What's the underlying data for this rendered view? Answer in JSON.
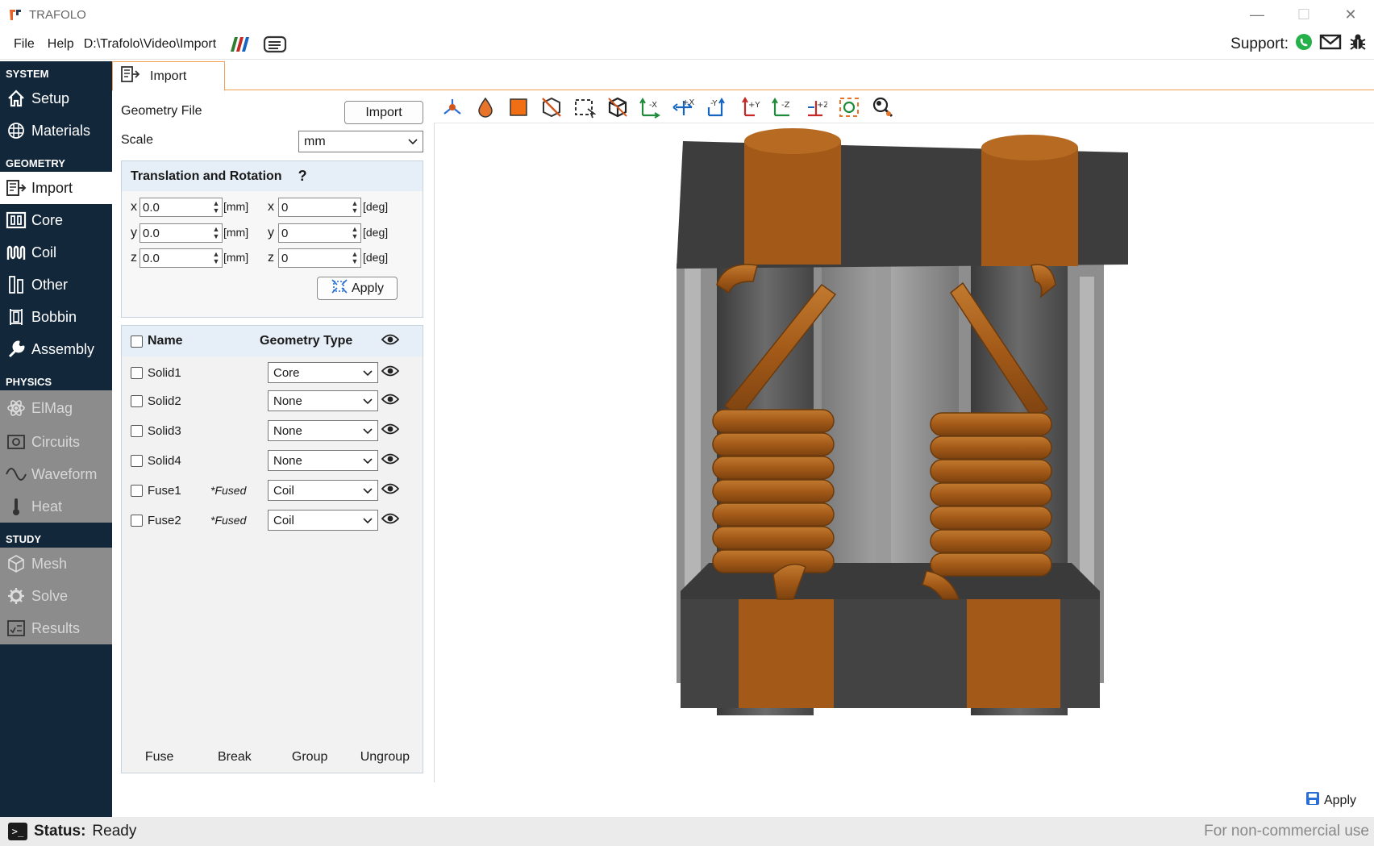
{
  "window": {
    "title": "TRAFOLO",
    "minimize": "—",
    "maximize": "☐",
    "close": "✕"
  },
  "menubar": {
    "file": "File",
    "help": "Help",
    "path": "D:\\Trafolo\\Video\\Import",
    "support_label": "Support:"
  },
  "sidebar": {
    "system_header": "SYSTEM",
    "setup": "Setup",
    "materials": "Materials",
    "geometry_header": "GEOMETRY",
    "import": "Import",
    "core": "Core",
    "coil": "Coil",
    "other": "Other",
    "bobbin": "Bobbin",
    "assembly": "Assembly",
    "physics_header": "PHYSICS",
    "elmag": "ElMag",
    "circuits": "Circuits",
    "waveform": "Waveform",
    "heat": "Heat",
    "study_header": "STUDY",
    "mesh": "Mesh",
    "solve": "Solve",
    "results": "Results"
  },
  "tab": {
    "label": "Import"
  },
  "panel": {
    "geometry_file_label": "Geometry File",
    "import_button": "Import",
    "scale_label": "Scale",
    "scale_value": "mm",
    "translation_title": "Translation and Rotation",
    "help_mark": "?",
    "trans": {
      "x_label": "x",
      "x_value": "0.0",
      "x_unit": "[mm]",
      "y_label": "y",
      "y_value": "0.0",
      "y_unit": "[mm]",
      "z_label": "z",
      "z_value": "0.0",
      "z_unit": "[mm]"
    },
    "rot": {
      "x_label": "x",
      "x_value": "0",
      "x_unit": "[deg]",
      "y_label": "y",
      "y_value": "0",
      "y_unit": "[deg]",
      "z_label": "z",
      "z_value": "0",
      "z_unit": "[deg]"
    },
    "apply_button": "Apply",
    "table": {
      "col_name": "Name",
      "col_type": "Geometry Type",
      "rows": [
        {
          "name": "Solid1",
          "fused": "",
          "type": "Core"
        },
        {
          "name": "Solid2",
          "fused": "",
          "type": "None"
        },
        {
          "name": "Solid3",
          "fused": "",
          "type": "None"
        },
        {
          "name": "Solid4",
          "fused": "",
          "type": "None"
        },
        {
          "name": "Fuse1",
          "fused": "*Fused",
          "type": "Coil"
        },
        {
          "name": "Fuse2",
          "fused": "*Fused",
          "type": "Coil"
        }
      ]
    },
    "footer": {
      "fuse": "Fuse",
      "break": "Break",
      "group": "Group",
      "ungroup": "Ungroup"
    }
  },
  "toolbar": {
    "labels": {
      "neg_x": "-X",
      "pos_x": "+X",
      "neg_y": "-Y",
      "pos_y": "+Y",
      "neg_z": "-Z",
      "pos_z": "+Z"
    }
  },
  "bottom_apply": "Apply",
  "status": {
    "label": "Status:",
    "value": "Ready",
    "note": "For non-commercial use"
  },
  "colors": {
    "sidebar_bg": "#13273b",
    "accent_orange": "#f0a050",
    "copper": "#a8601e",
    "core": "#3f3f3f"
  }
}
